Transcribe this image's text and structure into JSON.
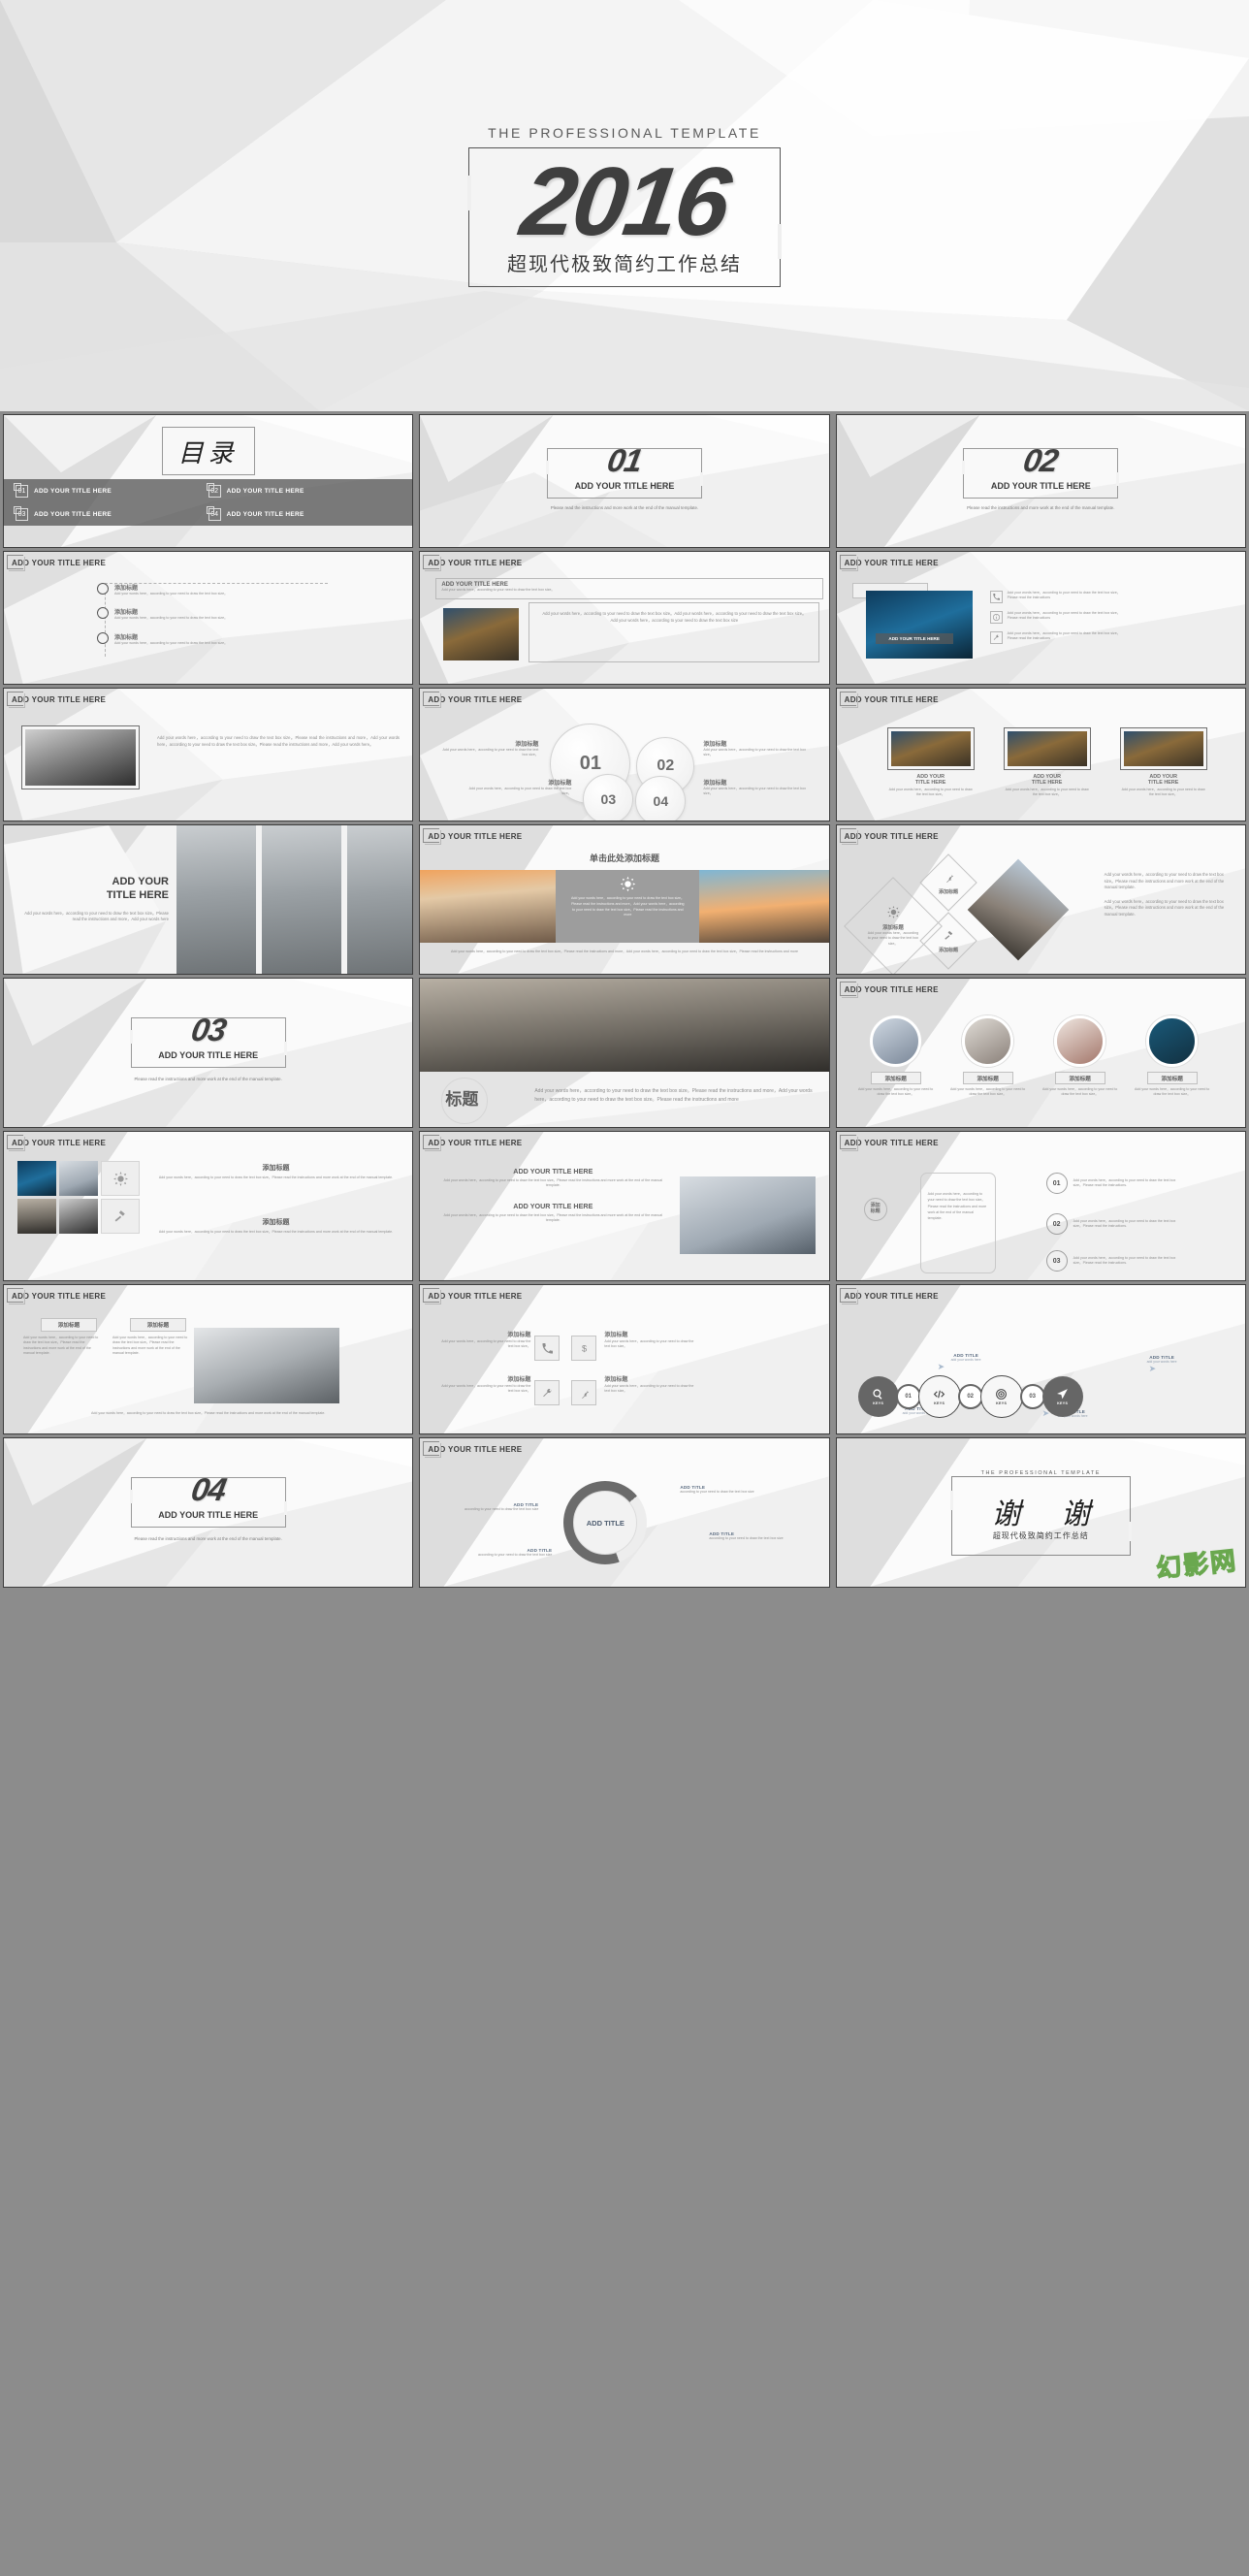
{
  "hero": {
    "kicker": "THE PROFESSIONAL TEMPLATE",
    "year": "2016",
    "subtitle": "超现代极致简约工作总结"
  },
  "common": {
    "slide_title": "ADD YOUR TITLE HERE",
    "cn_title": "添加标题",
    "body_short": "Add your words here，according to your need to draw the text box size。",
    "body_med": "Add your words here，according to your need to draw the text box size。Please read the instructions and more。",
    "body_long": "Add your words here，according to your need to draw the text box size。Please read the instructions and more，Add your words here，according to your need to draw the text box size。Please read the instructions and more",
    "body_manual": "Add your words here，according to your need to draw the text box size。Please read the instructions and more work at the end of the manual template.",
    "divider_note": "Please read the instructions and more work at the end of the manual template.",
    "instructions_short": "Add your words here，according to your need to draw the text box size。Please read the instructions."
  },
  "toc": {
    "heading": "目录",
    "items": [
      {
        "num": "01",
        "label": "ADD YOUR TITLE HERE"
      },
      {
        "num": "02",
        "label": "ADD YOUR TITLE HERE"
      },
      {
        "num": "03",
        "label": "ADD YOUR TITLE HERE"
      },
      {
        "num": "04",
        "label": "ADD YOUR TITLE HERE"
      }
    ]
  },
  "dividers": [
    {
      "num": "01",
      "title": "ADD YOUR TITLE HERE"
    },
    {
      "num": "02",
      "title": "ADD YOUR TITLE HERE"
    },
    {
      "num": "03",
      "title": "ADD YOUR TITLE HERE"
    },
    {
      "num": "04",
      "title": "ADD YOUR TITLE HERE"
    }
  ],
  "slide_timeline": {
    "title": "ADD YOUR TITLE HERE",
    "rows": [
      {
        "label": "添加标题",
        "text": "Add your words here，according to your need to draw the text box size。"
      },
      {
        "label": "添加标题",
        "text": "Add your words here，according to your need to draw the text box size。"
      },
      {
        "label": "添加标题",
        "text": "Add your words here，according to your need to draw the text box size。"
      }
    ]
  },
  "slide_photo_text": {
    "title": "ADD YOUR TITLE HERE",
    "inner_title": "ADD YOUR TITLE HERE",
    "inner_sub": "Add your words here，according to your need to draw the text box size。",
    "body": "Add your words here，according to your need to draw the text box size。Add your words here，according to your need to draw the text box size。Add your words here，according to your need to draw the text box size"
  },
  "slide_contact": {
    "title": "ADD YOUR TITLE HERE",
    "caption": "ADD YOUR TITLE HERE",
    "rows": [
      {
        "icon": "phone-icon",
        "text": "Add your words here，according to your need to draw the text box size。Please read the instructions"
      },
      {
        "icon": "info-icon",
        "text": "Add your words here，according to your need to draw the text box size。Please read the instructions"
      },
      {
        "icon": "tool-icon",
        "text": "Add your words here，according to your need to draw the text box size。Please read the instructions"
      }
    ]
  },
  "slide_chess": {
    "title": "ADD YOUR TITLE HERE",
    "body": "Add your words here，according to your need to draw the text box size。Please read the instructions and more，Add your words here，according to your need to draw the text box size。Please read the instructions and more，Add your words here。"
  },
  "slide_circles": {
    "title": "ADD YOUR TITLE HERE",
    "items": [
      {
        "num": "01",
        "label": "添加标题",
        "text": "Add your words here，according to your need to draw the text box size。"
      },
      {
        "num": "02",
        "label": "添加标题",
        "text": "Add your words here，according to your need to draw the text box size。"
      },
      {
        "num": "03",
        "label": "添加标题",
        "text": "Add your words here，according to your need to draw the text box size。"
      },
      {
        "num": "04",
        "label": "添加标题",
        "text": "Add your words here，according to your need to draw the text box size。"
      }
    ]
  },
  "slide_three_pics": {
    "title": "ADD YOUR TITLE HERE",
    "items": [
      {
        "label": "ADD YOUR\nTITLE HERE",
        "text": "Add your words here，according to your need to draw the text box size。"
      },
      {
        "label": "ADD YOUR\nTITLE HERE",
        "text": "Add your words here，according to your need to draw the text box size。"
      },
      {
        "label": "ADD YOUR\nTITLE HERE",
        "text": "Add your words here，according to your need to draw the text box size。"
      }
    ]
  },
  "slide_city": {
    "title": "ADD YOUR\nTITLE HERE",
    "body": "Add your words here，according to your need to draw the text box size。Please read the instructions and more，Add your words here"
  },
  "slide_sunset": {
    "title": "ADD YOUR TITLE HERE",
    "center_title": "单击此处添加标题",
    "center_icon": "sun-icon",
    "center_body": "Add your words here，according to your need to draw the text box size。Please read the instructions and more，Add your words here，according to your need to draw the text box size。Please read the instructions and more",
    "footer": "Add your words here，according to your need to draw the text box size。Please read the instructions and more，Add your words here，according to your need to draw the text box size。Please read the instructions and more"
  },
  "slide_diamonds": {
    "title": "ADD YOUR TITLE HERE",
    "items": [
      {
        "icon": "pin-icon",
        "label": "添加标题"
      },
      {
        "icon": "sun-icon",
        "label": "添加标题",
        "text": "Add your words here，according to your need to draw the text box size。"
      },
      {
        "icon": "gavel-icon",
        "label": "添加标题"
      }
    ],
    "paragraphs": [
      "Add your words here，according to your need to draw the text box size。Please read the instructions and more work at the end of the manual template.",
      "Add your words here，according to your need to draw the text box size。Please read the instructions and more work at the end of the manual template."
    ]
  },
  "slide_meeting": {
    "big_label": "标题",
    "body": "Add your words here，according to your need to draw the text box size。Please read the instructions and more，Add your words here，according to your need to draw the text box size。Please read the instructions and more"
  },
  "slide_team": {
    "title": "ADD YOUR TITLE HERE",
    "members": [
      {
        "label": "添加标题",
        "text": "Add your words here，according to your need to draw the text box size。"
      },
      {
        "label": "添加标题",
        "text": "Add your words here，according to your need to draw the text box size。"
      },
      {
        "label": "添加标题",
        "text": "Add your words here，according to your need to draw the text box size。"
      },
      {
        "label": "添加标题",
        "text": "Add your words here，according to your need to draw the text box size。"
      }
    ]
  },
  "slide_mosaic": {
    "title": "ADD YOUR TITLE HERE",
    "blocks": [
      {
        "label": "添加标题",
        "text": "Add your words here，according to your need to draw the text box size。Please read the instructions and more work at the end of the manual template."
      },
      {
        "label": "添加标题",
        "text": "Add your words here，according to your need to draw the text box size。Please read the instructions and more work at the end of the manual template."
      }
    ]
  },
  "slide_office": {
    "title": "ADD YOUR TITLE HERE",
    "lines": [
      "ADD YOUR TITLE HERE",
      "ADD YOUR TITLE HERE"
    ],
    "body": "Add your words here，according to your need to draw the text box size。Please read the instructions and more work at the end of the manual template.",
    "body2": "Add your words here，according to your need to draw the text box size。Please read the instructions and more work at the end of the manual template."
  },
  "slide_numlist": {
    "title": "ADD YOUR TITLE HERE",
    "badge": "添加\n标题",
    "center": "Add your words here，according to your need to draw the text box size。Please read the instructions and more work at the end of the manual template.",
    "items": [
      {
        "num": "01",
        "text": "Add your words here，according to your need to draw the text box size。Please read the instructions."
      },
      {
        "num": "02",
        "text": "Add your words here，according to your need to draw the text box size。Please read the instructions."
      },
      {
        "num": "03",
        "text": "Add your words here，according to your need to draw the text box size。Please read the instructions."
      }
    ]
  },
  "slide_keyboard": {
    "title": "ADD YOUR TITLE HERE",
    "tabs": [
      "添加标题",
      "添加标题"
    ],
    "body_left": "Add your words here，according to your need to draw the text box size。Please read the instructions and more work at the end of the manual template.",
    "body_right": "Add your words here，according to your need to draw the text box size。Please read the instructions and more work at the end of the manual template.",
    "footer": "Add your words here，according to your need to draw the text box size。Please read the instructions and more work at the end of the manual template."
  },
  "slide_icon_grid": {
    "title": "ADD YOUR TITLE HERE",
    "items": [
      {
        "icon": "phone-icon",
        "label": "添加标题",
        "text": "Add your words here，according to your need to draw the text box size。"
      },
      {
        "icon": "dollar-icon",
        "label": "添加标题",
        "text": "Add your words here，according to your need to draw the text box size。"
      },
      {
        "icon": "pin-icon",
        "label": "添加标题",
        "text": "Add your words here，according to your need to draw the text box size。"
      },
      {
        "icon": "wrench-icon",
        "label": "添加标题",
        "text": "Add your words here，according to your need to draw the text box size。"
      }
    ]
  },
  "slide_keys": {
    "title": "ADD YOUR TITLE HERE",
    "keys_label": "KEYS",
    "nodes": [
      {
        "icon": "search-icon",
        "label": "KEYS",
        "style": "dark"
      },
      {
        "num": "01"
      },
      {
        "icon": "code-icon",
        "label": "KEYS",
        "style": "light"
      },
      {
        "num": "02"
      },
      {
        "icon": "target-icon",
        "label": "KEYS",
        "style": "light"
      },
      {
        "num": "03"
      },
      {
        "icon": "send-icon",
        "label": "KEYS",
        "style": "dark"
      }
    ],
    "callouts": [
      {
        "title": "ADD TITLE",
        "sub": "add your words here"
      },
      {
        "title": "ADD TITLE",
        "sub": "add your words here"
      },
      {
        "title": "ADD TITLE",
        "sub": "add your words here"
      },
      {
        "title": "ADD TITLE",
        "sub": "add your words here"
      }
    ]
  },
  "slide_donut": {
    "title": "ADD YOUR TITLE HERE",
    "center_label": "ADD TITLE",
    "callouts": [
      {
        "title": "ADD TITLE",
        "text": "according to your need to draw the text box size"
      },
      {
        "title": "ADD TITLE",
        "text": "according to your need to draw the text box size"
      },
      {
        "title": "ADD TITLE",
        "text": "according to your need to draw the text box size"
      },
      {
        "title": "ADD TITLE",
        "text": "according to your need to draw the text box size"
      }
    ]
  },
  "thanks": {
    "kicker": "THE PROFESSIONAL TEMPLATE",
    "main": "谢  谢",
    "subtitle": "超现代极致简约工作总结",
    "watermark": "幻影网"
  }
}
